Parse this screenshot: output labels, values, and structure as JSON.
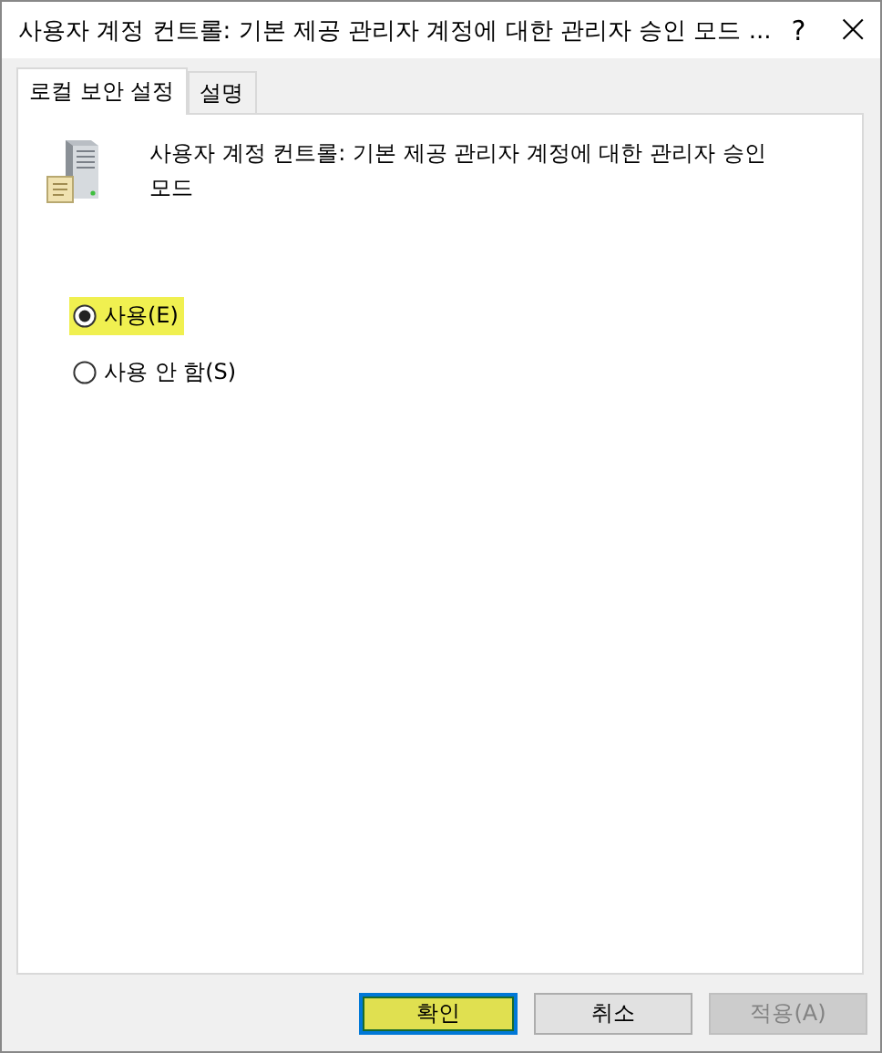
{
  "window": {
    "title": "사용자 계정 컨트롤: 기본 제공 관리자 계정에 대한 관리자 승인 모드 ...",
    "help": "?",
    "close": "×"
  },
  "tabs": [
    {
      "label": "로컬 보안 설정",
      "selected": true
    },
    {
      "label": "설명",
      "selected": false
    }
  ],
  "policy": {
    "description": "사용자 계정 컨트롤: 기본 제공 관리자 계정에 대한 관리자 승인 모드"
  },
  "options": [
    {
      "label": "사용(E)",
      "selected": true,
      "highlighted": true
    },
    {
      "label": "사용 안 함(S)",
      "selected": false,
      "highlighted": false
    }
  ],
  "buttons": [
    {
      "label": "확인",
      "disabled": false,
      "highlighted": true
    },
    {
      "label": "취소",
      "disabled": false,
      "highlighted": false
    },
    {
      "label": "적용(A)",
      "disabled": true,
      "highlighted": false
    }
  ]
}
